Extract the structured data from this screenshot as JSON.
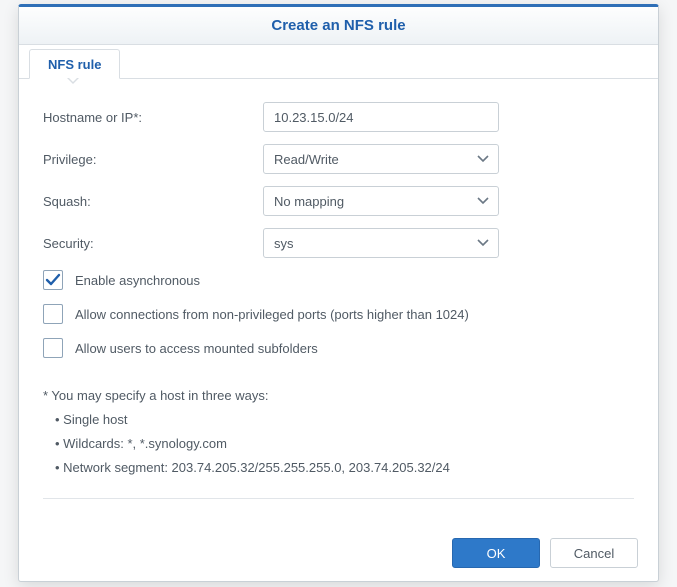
{
  "dialog": {
    "title": "Create an NFS rule",
    "tab": "NFS rule"
  },
  "fields": {
    "hostname": {
      "label": "Hostname or IP*:",
      "value": "10.23.15.0/24"
    },
    "privilege": {
      "label": "Privilege:",
      "value": "Read/Write"
    },
    "squash": {
      "label": "Squash:",
      "value": "No mapping"
    },
    "security": {
      "label": "Security:",
      "value": "sys"
    }
  },
  "checks": {
    "async": {
      "label": "Enable asynchronous",
      "checked": true
    },
    "nonpriv": {
      "label": "Allow connections from non-privileged ports (ports higher than 1024)",
      "checked": false
    },
    "subfolders": {
      "label": "Allow users to access mounted subfolders",
      "checked": false
    }
  },
  "help": {
    "intro": "* You may specify a host in three ways:",
    "b1": "• Single host",
    "b2": "• Wildcards: *, *.synology.com",
    "b3": "• Network segment: 203.74.205.32/255.255.255.0, 203.74.205.32/24"
  },
  "buttons": {
    "ok": "OK",
    "cancel": "Cancel"
  }
}
